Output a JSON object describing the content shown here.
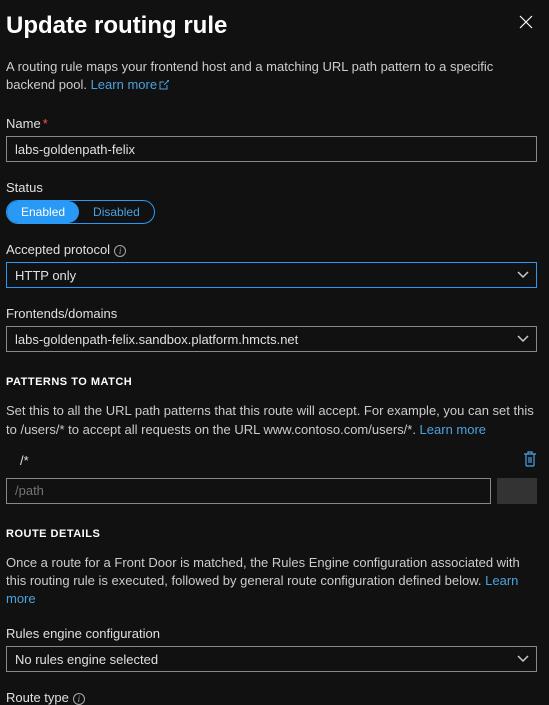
{
  "header": {
    "title": "Update routing rule"
  },
  "intro": {
    "text": "A routing rule maps your frontend host and a matching URL path pattern to a specific backend pool. ",
    "learn_more": "Learn more"
  },
  "name": {
    "label": "Name",
    "value": "labs-goldenpath-felix"
  },
  "status": {
    "label": "Status",
    "enabled": "Enabled",
    "disabled": "Disabled"
  },
  "protocol": {
    "label": "Accepted protocol",
    "value": "HTTP only"
  },
  "frontends": {
    "label": "Frontends/domains",
    "value": "labs-goldenpath-felix.sandbox.platform.hmcts.net"
  },
  "patterns": {
    "header": "PATTERNS TO MATCH",
    "desc": "Set this to all the URL path patterns that this route will accept. For example, you can set this to /users/* to accept all requests on the URL www.contoso.com/users/*. ",
    "learn_more": "Learn more",
    "items": [
      "/*"
    ],
    "placeholder": "/path"
  },
  "route": {
    "header": "ROUTE DETAILS",
    "desc": "Once a route for a Front Door is matched, the Rules Engine configuration associated with this routing rule is executed, followed by general route configuration defined below. ",
    "learn_more": "Learn more"
  },
  "rules_engine": {
    "label": "Rules engine configuration",
    "value": "No rules engine selected"
  },
  "route_type": {
    "label": "Route type"
  }
}
